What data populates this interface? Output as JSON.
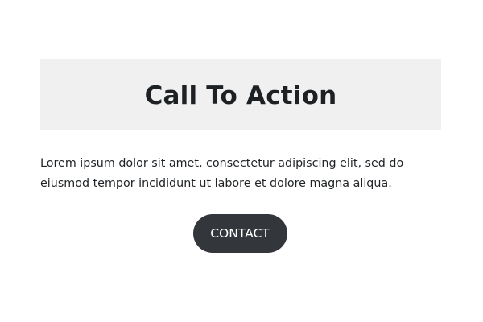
{
  "hero": {
    "title": "Call To Action",
    "body": "Lorem ipsum dolor sit amet, consectetur adipiscing elit, sed do eiusmod tempor incididunt ut labore et dolore magna aliqua.",
    "button_label": "CONTACT"
  },
  "colors": {
    "heading_background": "#f0f0f0",
    "button_background": "#33373b",
    "button_text": "#ffffff",
    "text": "#1f2326"
  }
}
